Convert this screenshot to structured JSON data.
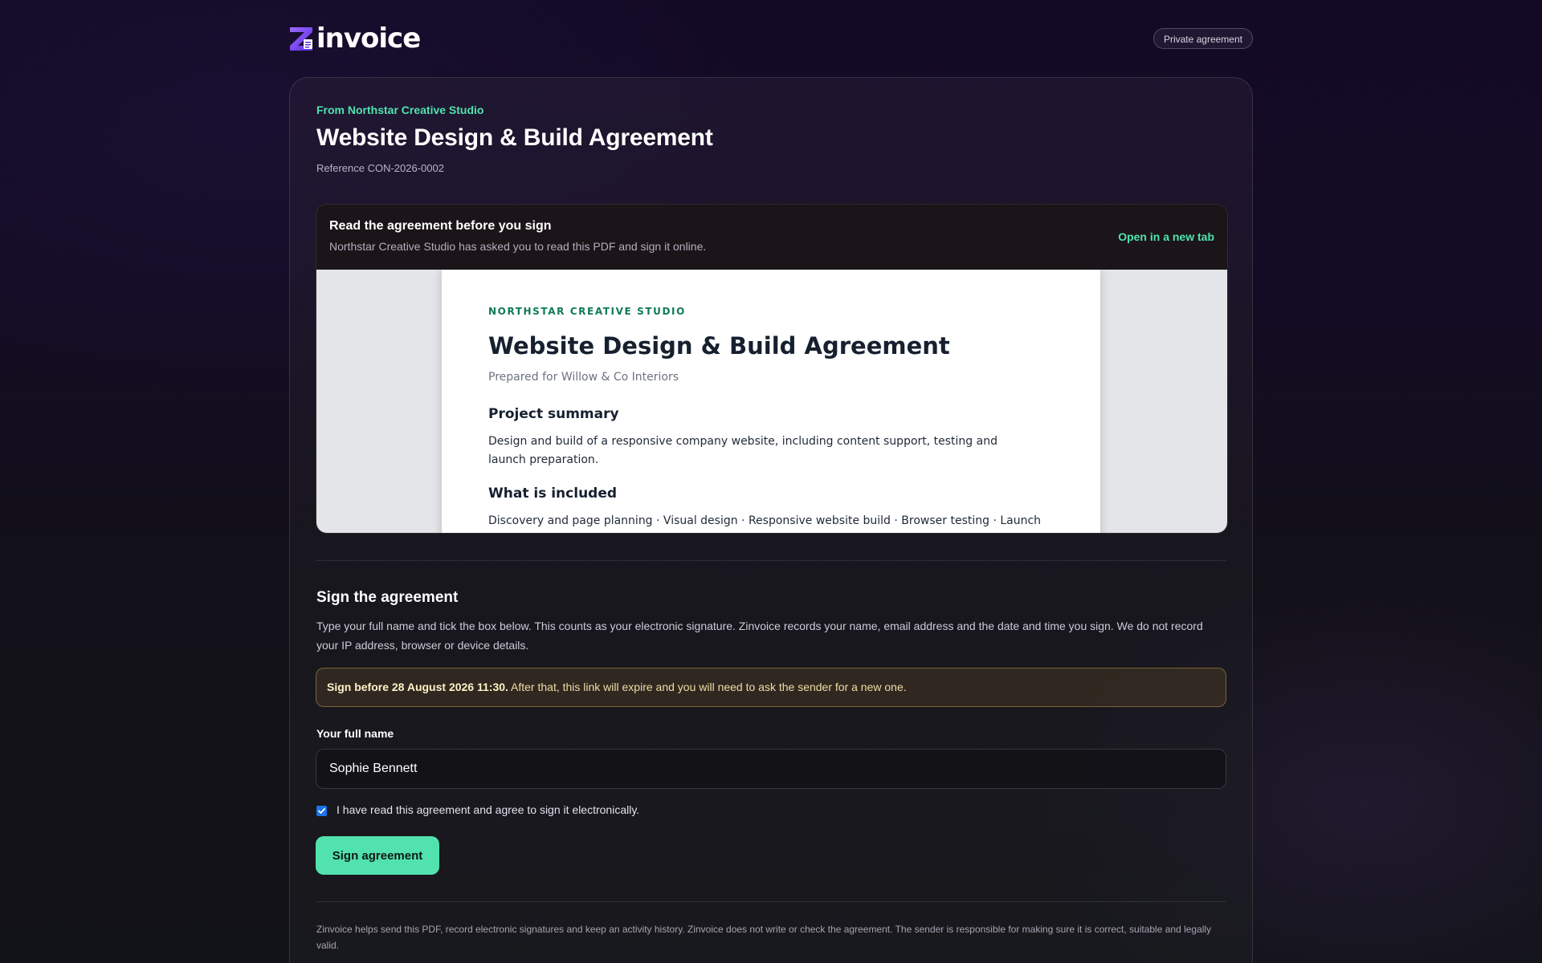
{
  "brand": {
    "name": "invoice",
    "logo_icon": "zinvoice-logo-icon",
    "accent_color": "#52e2ad",
    "logo_color": "#7b4dff"
  },
  "header": {
    "badge": "Private agreement"
  },
  "agreement": {
    "from_label": "From Northstar Creative Studio",
    "title": "Website Design & Build Agreement",
    "reference": "Reference CON-2026-0002"
  },
  "viewer": {
    "title": "Read the agreement before you sign",
    "subtitle": "Northstar Creative Studio has asked you to read this PDF and sign it online.",
    "open_new_tab": "Open in a new tab"
  },
  "pdf": {
    "company": "NORTHSTAR CREATIVE STUDIO",
    "title": "Website Design & Build Agreement",
    "prepared_for": "Prepared for Willow & Co Interiors",
    "section1_title": "Project summary",
    "section1_body": "Design and build of a responsive company website, including content support, testing and launch preparation.",
    "section2_title": "What is included",
    "section2_body": "Discovery and page planning · Visual design · Responsive website build · Browser testing · Launch"
  },
  "sign": {
    "title": "Sign the agreement",
    "description": "Type your full name and tick the box below. This counts as your electronic signature. Zinvoice records your name, email address and the date and time you sign. We do not record your IP address, browser or device details.",
    "deadline_strong": "Sign before 28 August 2026 11:30.",
    "deadline_rest": " After that, this link will expire and you will need to ask the sender for a new one.",
    "name_label": "Your full name",
    "name_value": "Sophie Bennett",
    "agree_label": "I have read this agreement and agree to sign it electronically.",
    "agree_checked": true,
    "button_label": "Sign agreement"
  },
  "footer": {
    "disclaimer": "Zinvoice helps send this PDF, record electronic signatures and keep an activity history. Zinvoice does not write or check the agreement. The sender is responsible for making sure it is correct, suitable and legally valid."
  }
}
